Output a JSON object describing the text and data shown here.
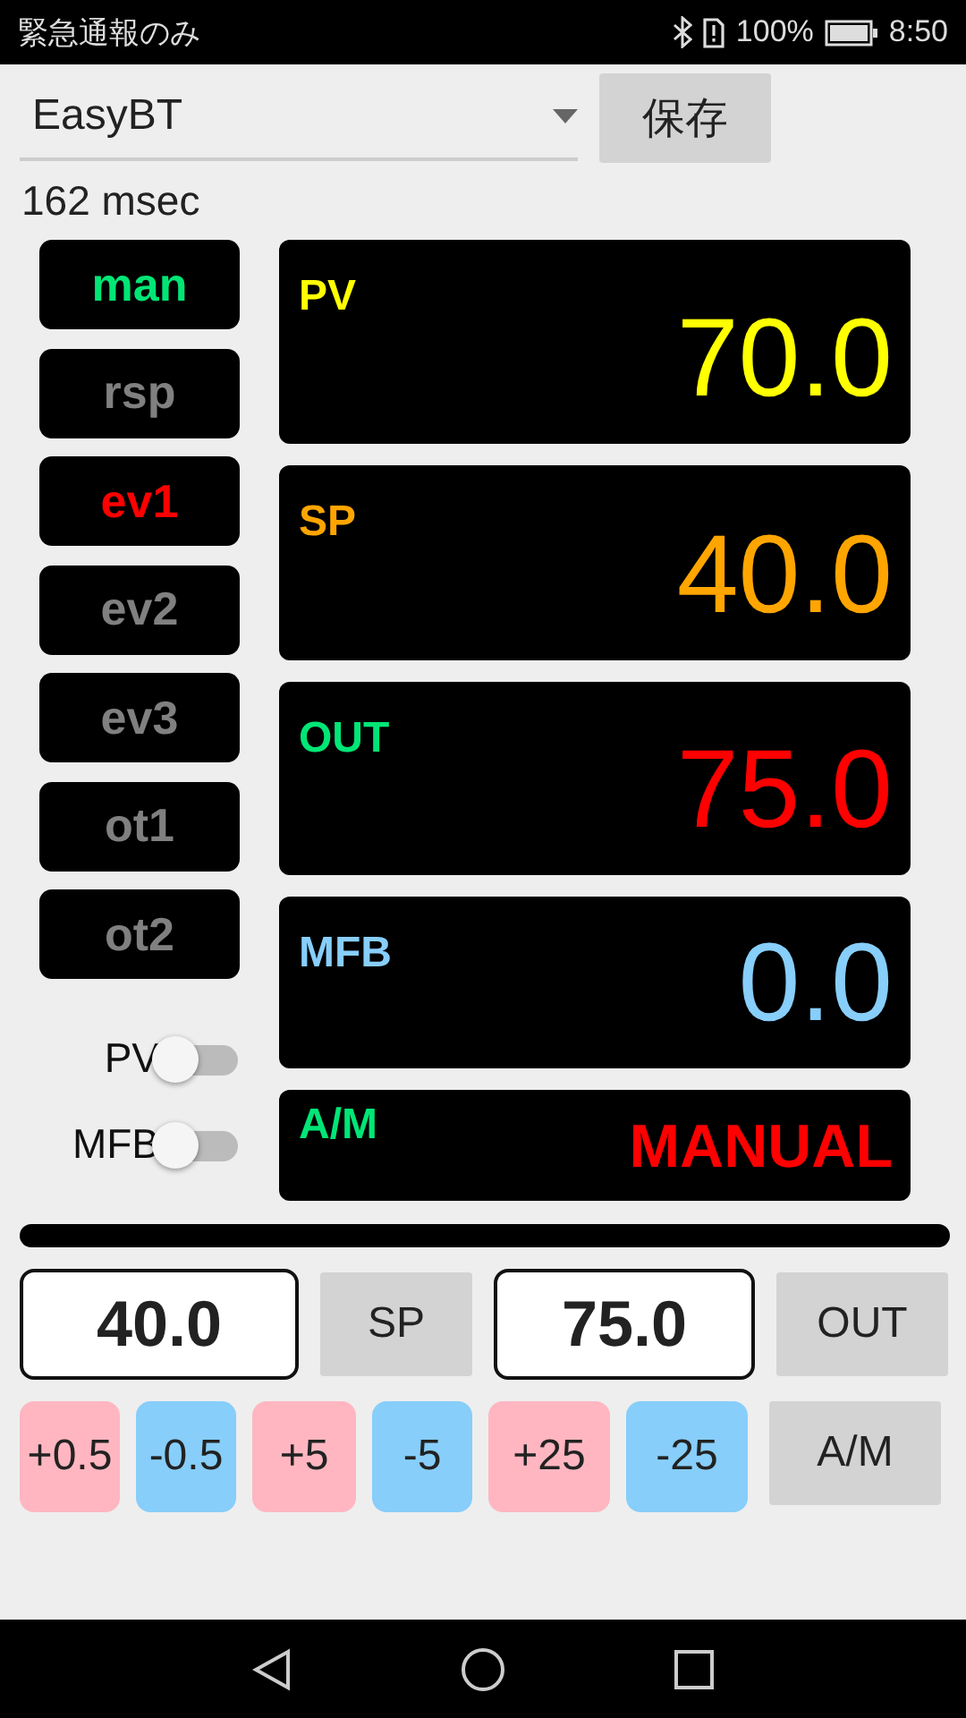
{
  "status_bar": {
    "carrier": "緊急通報のみ",
    "battery_text": "100%",
    "time": "8:50"
  },
  "device_select": {
    "value": "EasyBT"
  },
  "save_button": "保存",
  "latency": "162 msec",
  "lamps": [
    {
      "label": "man",
      "on": true,
      "color": "#00e676"
    },
    {
      "label": "rsp",
      "on": false
    },
    {
      "label": "ev1",
      "on": true,
      "color": "#ff0000"
    },
    {
      "label": "ev2",
      "on": false
    },
    {
      "label": "ev3",
      "on": false
    },
    {
      "label": "ot1",
      "on": false
    },
    {
      "label": "ot2",
      "on": false
    }
  ],
  "switches": [
    {
      "label": "PV",
      "on": false
    },
    {
      "label": "MFB",
      "on": false
    }
  ],
  "displays": [
    {
      "kind": "value",
      "label": {
        "text": "PV",
        "color": "#ffff00"
      },
      "value": {
        "text": "70.0",
        "color": "#ffff00"
      }
    },
    {
      "kind": "value",
      "label": {
        "text": "SP",
        "color": "#ffa500"
      },
      "value": {
        "text": "40.0",
        "color": "#ffa500"
      }
    },
    {
      "kind": "value",
      "label": {
        "text": "OUT",
        "color": "#00e676"
      },
      "value": {
        "text": "75.0",
        "color": "#ff0000"
      }
    },
    {
      "kind": "value",
      "label": {
        "text": "MFB",
        "color": "#87cefa"
      },
      "value": {
        "text": "0.0",
        "color": "#87cefa"
      }
    },
    {
      "kind": "mode",
      "label": {
        "text": "A/M",
        "color": "#00e676"
      },
      "value": {
        "text": "MANUAL",
        "color": "#ff0000"
      }
    }
  ],
  "sp_input": {
    "value": "40.0"
  },
  "sp_button": "SP",
  "out_input": {
    "value": "75.0"
  },
  "out_button": "OUT",
  "steps": [
    {
      "label": "+0.5",
      "color": "#ffb6c1"
    },
    {
      "label": "-0.5",
      "color": "#87cefa"
    },
    {
      "label": "+5",
      "color": "#ffb6c1"
    },
    {
      "label": "-5",
      "color": "#87cefa"
    },
    {
      "label": "+25",
      "color": "#ffb6c1"
    },
    {
      "label": "-25",
      "color": "#87cefa"
    }
  ],
  "am_button": "A/M"
}
